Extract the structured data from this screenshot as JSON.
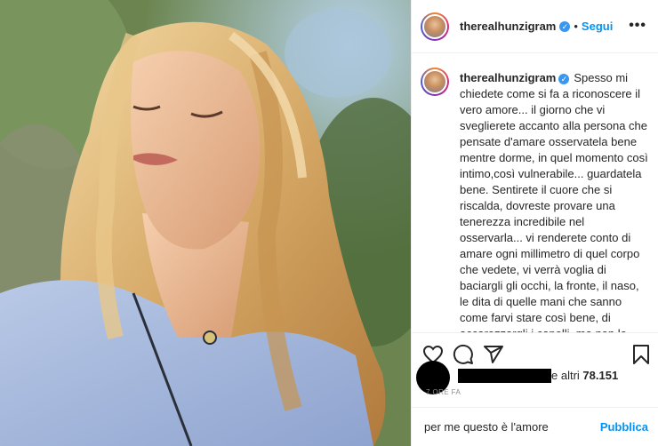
{
  "post": {
    "image_alt": "Woman with long blonde hair and closed eyes in the sun",
    "header": {
      "username": "therealhunzigram",
      "separator": "•",
      "follow_label": "Segui",
      "more_label": "•••"
    },
    "caption": {
      "username": "therealhunzigram",
      "text": "Spesso mi chiedete come si fa a riconoscere il vero amore... il giorno che vi sveglierete accanto alla persona che pensate d'amare osservatela bene mentre dorme, in quel momento così intimo,così vulnerabile... guardatela bene. Sentirete il cuore che si riscalda, dovreste provare una tenerezza incredibile nel osservarla... vi renderete conto di amare ogni millimetro di quel corpo che vedete, vi verrà voglia di baciargli gli occhi, la fronte, il naso, le dita di quelle mani che sanno come farvi stare così bene, di accarezzargli i capelli, ma non lo farete solo perché sarebbe un peccato incredibile svegliarla. In quel momento sentirete se questa sarà la persona con la quale vorrete"
    },
    "likes": {
      "suffix": "e altri ",
      "count": "78.151"
    },
    "time_ago": "7 ORE FA",
    "comment": {
      "value": "per me questo è l'amore",
      "publish_label": "Pubblica"
    },
    "icons": [
      "heart-icon",
      "comment-icon",
      "share-icon",
      "bookmark-icon",
      "verified-icon"
    ],
    "colors": {
      "accent": "#0095f6",
      "verified": "#3897f0",
      "text": "#262626",
      "muted": "#8e8e8e"
    }
  }
}
